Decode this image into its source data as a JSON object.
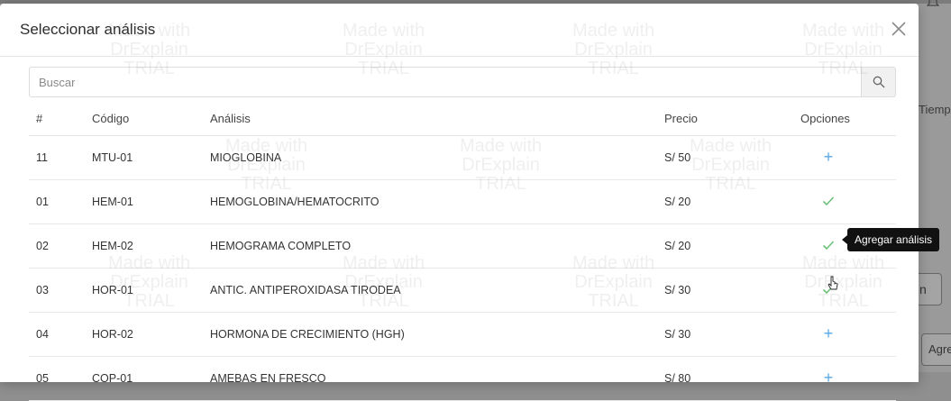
{
  "background": {
    "right_labels": [
      "Tiemp",
      "Agre"
    ],
    "right_glyph": "n"
  },
  "modal": {
    "title": "Seleccionar análisis",
    "close_icon": "close-icon"
  },
  "search": {
    "placeholder": "Buscar",
    "value": "",
    "icon": "search-icon"
  },
  "table": {
    "headers": {
      "num": "#",
      "code": "Código",
      "name": "Análisis",
      "price": "Precio",
      "options": "Opciones"
    },
    "rows": [
      {
        "num": "11",
        "code": "MTU-01",
        "name": "MIOGLOBINA",
        "price": "S/ 50",
        "option": "add"
      },
      {
        "num": "01",
        "code": "HEM-01",
        "name": "HEMOGLOBINA/HEMATOCRITO",
        "price": "S/ 20",
        "option": "selected"
      },
      {
        "num": "02",
        "code": "HEM-02",
        "name": "HEMOGRAMA COMPLETO",
        "price": "S/ 20",
        "option": "selected"
      },
      {
        "num": "03",
        "code": "HOR-01",
        "name": "ANTIC. ANTIPEROXIDASA TIRODEA",
        "price": "S/ 30",
        "option": "selected"
      },
      {
        "num": "04",
        "code": "HOR-02",
        "name": "HORMONA DE CRECIMIENTO (HGH)",
        "price": "S/ 30",
        "option": "add"
      },
      {
        "num": "05",
        "code": "COP-01",
        "name": "AMEBAS EN FRESCO",
        "price": "S/ 80",
        "option": "add"
      }
    ]
  },
  "tooltip": {
    "text": "Agregar análisis"
  },
  "watermark": {
    "line1": "Made with",
    "line2": "DrExplain",
    "line3": "TRIAL"
  },
  "colors": {
    "add": "#5aa9e6",
    "selected": "#6cc07a",
    "tooltip_bg": "#111111"
  }
}
